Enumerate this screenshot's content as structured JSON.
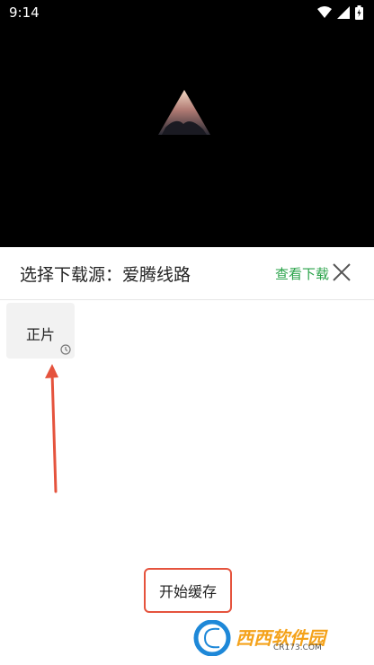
{
  "status": {
    "time": "9:14"
  },
  "header": {
    "title": "选择下载源：爱腾线路",
    "view_download": "查看下载"
  },
  "episodes": [
    {
      "label": "正片"
    }
  ],
  "actions": {
    "start_cache": "开始缓存"
  },
  "watermark": {
    "brand": "西西软件园",
    "url": "CR173.COM"
  },
  "colors": {
    "accent_green": "#2aa34a",
    "highlight_red": "#e5533d",
    "video_bg": "#000000"
  }
}
